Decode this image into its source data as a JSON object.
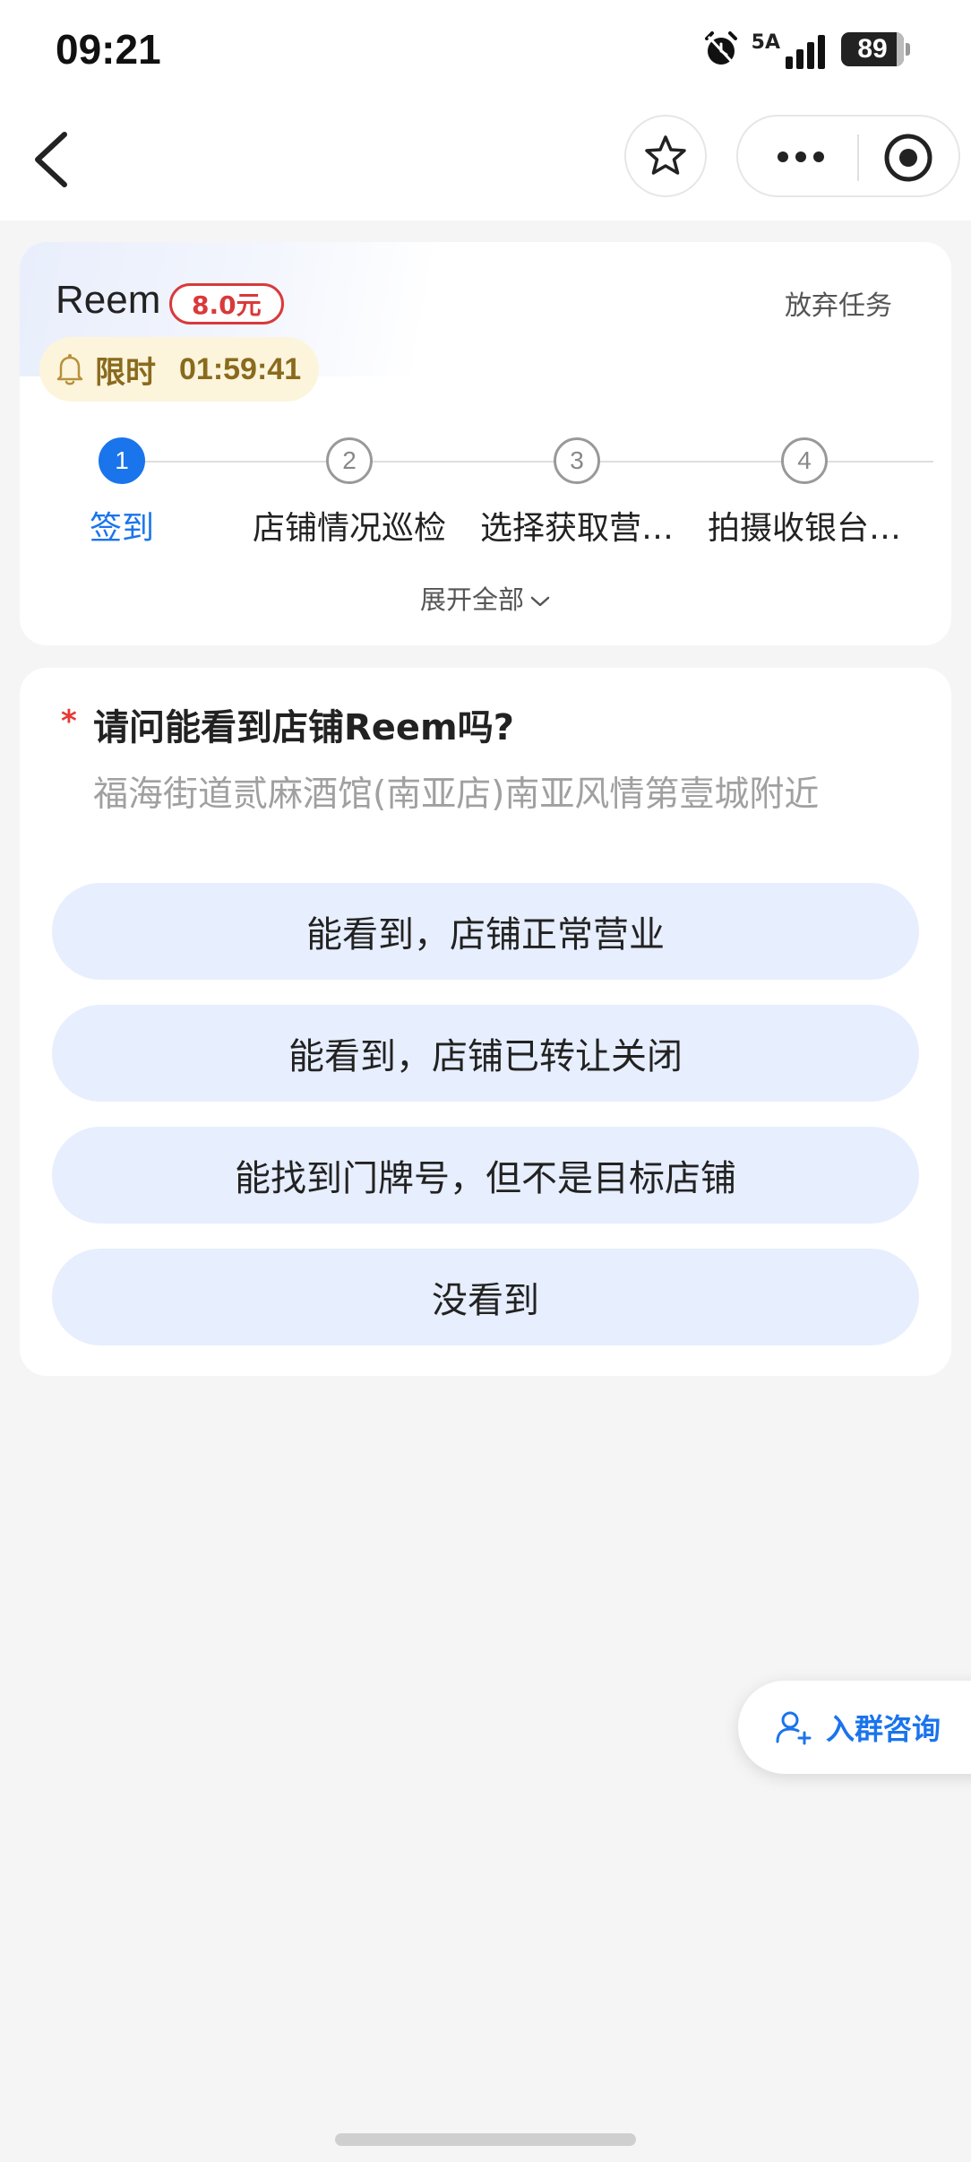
{
  "status_bar": {
    "time": "09:21",
    "network": "5A",
    "battery": "89"
  },
  "nav": {
    "icons": [
      "back-arrow-icon",
      "star-icon",
      "more-icon",
      "target-icon"
    ]
  },
  "task": {
    "store_name": "Reem",
    "reward": "8.0元",
    "abandon_label": "放弃任务",
    "timer_label": "限时",
    "timer_value": "01:59:41",
    "steps": [
      {
        "number": "1",
        "label": "签到",
        "active": true
      },
      {
        "number": "2",
        "label": "店铺情况巡检",
        "active": false
      },
      {
        "number": "3",
        "label": "选择获取营…",
        "active": false
      },
      {
        "number": "4",
        "label": "拍摄收银台…",
        "active": false
      }
    ],
    "expand_label": "展开全部"
  },
  "question": {
    "required": "*",
    "title": "请问能看到店铺Reem吗?",
    "address": "福海街道贰麻酒馆(南亚店)南亚风情第壹城附近",
    "options": [
      "能看到，店铺正常营业",
      "能看到，店铺已转让关闭",
      "能找到门牌号，但不是目标店铺",
      "没看到"
    ]
  },
  "consult": {
    "label": "入群咨询"
  },
  "colors": {
    "accent": "#1a74ec",
    "reward_red": "#d9393b",
    "option_bg": "#e7eefd",
    "timer_bg": "#fcf5dc"
  }
}
